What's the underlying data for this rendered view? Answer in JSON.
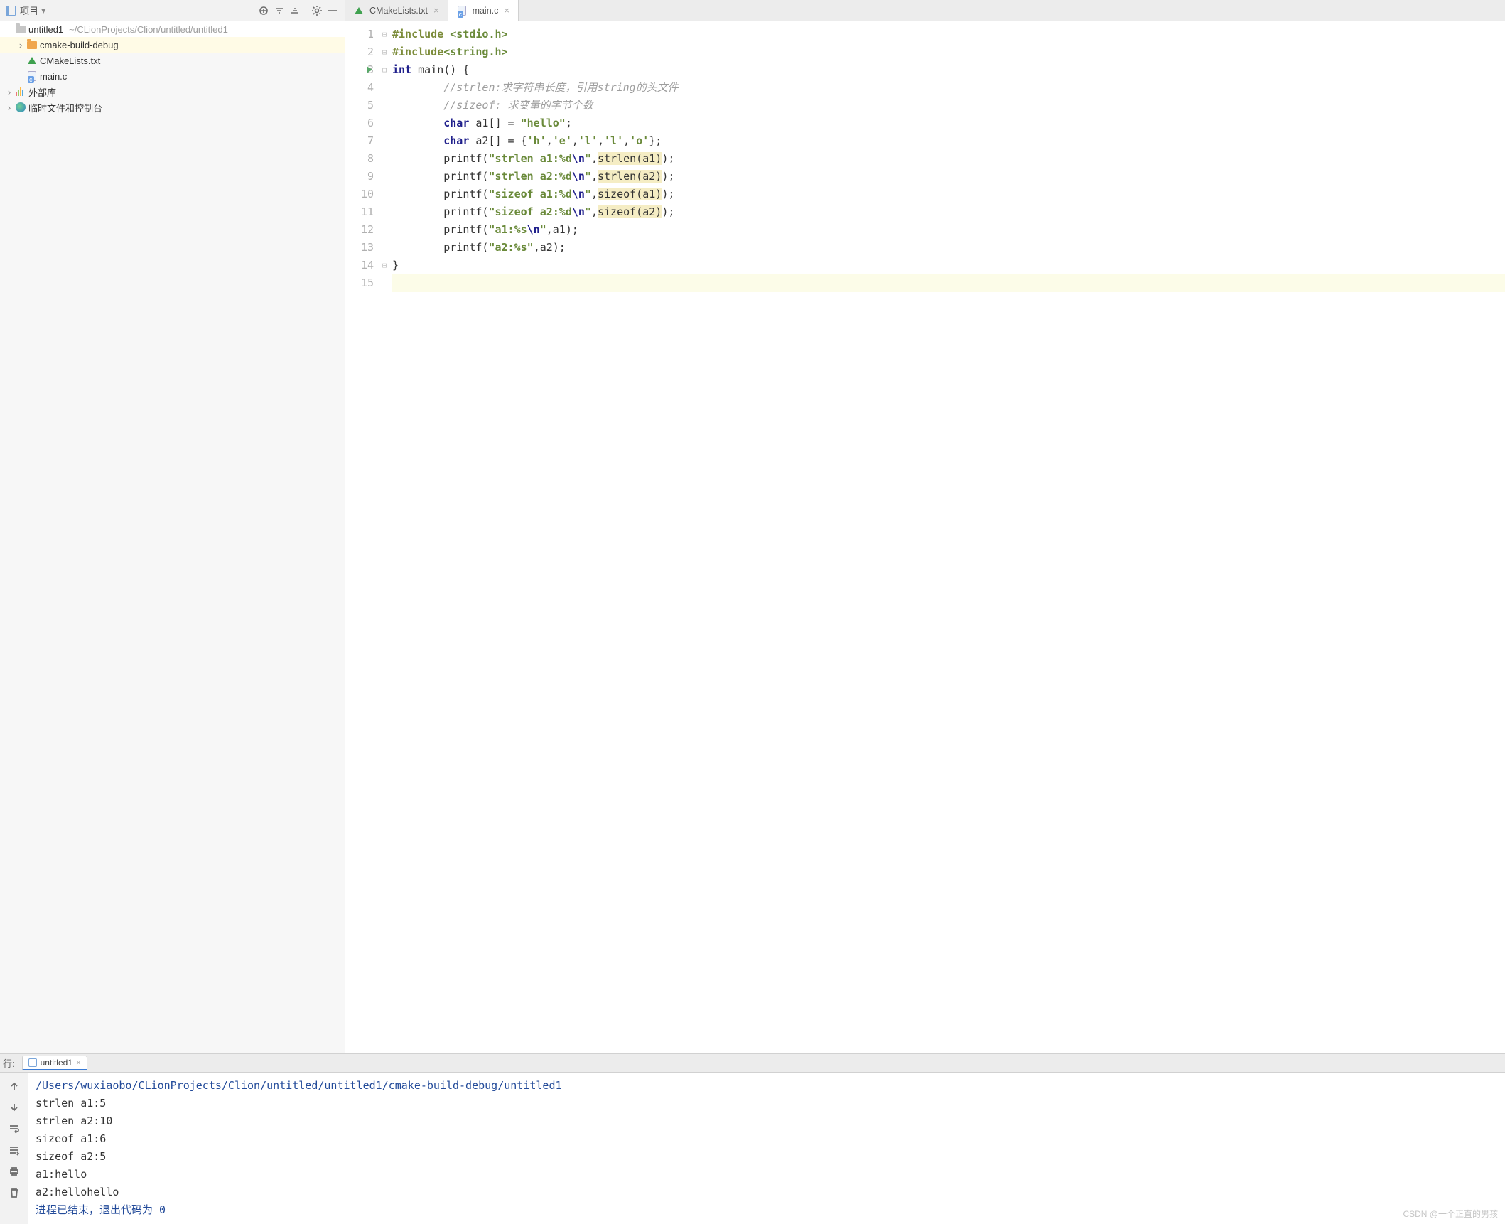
{
  "sidebar": {
    "title": "项目",
    "root": {
      "name": "untitled1",
      "path": "~/CLionProjects/Clion/untitled/untitled1"
    },
    "items": [
      {
        "name": "cmake-build-debug",
        "kind": "folder"
      },
      {
        "name": "CMakeLists.txt",
        "kind": "cmake"
      },
      {
        "name": "main.c",
        "kind": "cfile"
      }
    ],
    "external": "外部库",
    "scratch": "临时文件和控制台"
  },
  "tabs": [
    {
      "label": "CMakeLists.txt",
      "kind": "cmake",
      "active": false
    },
    {
      "label": "main.c",
      "kind": "cfile",
      "active": true
    }
  ],
  "code": {
    "lines": [
      [
        [
          "inc",
          "#include "
        ],
        [
          "inc-lib",
          "<stdio.h>"
        ]
      ],
      [
        [
          "inc",
          "#include"
        ],
        [
          "inc-lib",
          "<string.h>"
        ]
      ],
      [
        [
          "kw-navy",
          "int"
        ],
        [
          "",
          " main() {"
        ]
      ],
      [
        [
          "",
          "        "
        ],
        [
          "cm",
          "//strlen:求字符串长度，引用string的头文件"
        ]
      ],
      [
        [
          "",
          "        "
        ],
        [
          "cm",
          "//sizeof: 求变量的字节个数"
        ]
      ],
      [
        [
          "",
          "        "
        ],
        [
          "kw-navy",
          "char"
        ],
        [
          "",
          " a1[] = "
        ],
        [
          "str",
          "\"hello\""
        ],
        [
          "",
          ";"
        ]
      ],
      [
        [
          "",
          "        "
        ],
        [
          "kw-navy",
          "char"
        ],
        [
          "",
          " a2[] = {"
        ],
        [
          "str",
          "'h'"
        ],
        [
          "",
          ","
        ],
        [
          "str",
          "'e'"
        ],
        [
          "",
          ","
        ],
        [
          "str",
          "'l'"
        ],
        [
          "",
          ","
        ],
        [
          "str",
          "'l'"
        ],
        [
          "",
          ","
        ],
        [
          "str",
          "'o'"
        ],
        [
          "",
          "};"
        ]
      ],
      [
        [
          "",
          "        printf("
        ],
        [
          "str",
          "\"strlen a1:%d"
        ],
        [
          "esc",
          "\\n"
        ],
        [
          "str",
          "\""
        ],
        [
          "",
          ","
        ],
        [
          "warn-bg",
          "strlen(a1)"
        ],
        [
          "",
          ");"
        ]
      ],
      [
        [
          "",
          "        printf("
        ],
        [
          "str",
          "\"strlen a2:%d"
        ],
        [
          "esc",
          "\\n"
        ],
        [
          "str",
          "\""
        ],
        [
          "",
          ","
        ],
        [
          "warn-bg",
          "strlen(a2)"
        ],
        [
          "",
          ");"
        ]
      ],
      [
        [
          "",
          "        printf("
        ],
        [
          "str",
          "\"sizeof a1:%d"
        ],
        [
          "esc",
          "\\n"
        ],
        [
          "str",
          "\""
        ],
        [
          "",
          ","
        ],
        [
          "warn-bg",
          "sizeof(a1)"
        ],
        [
          "",
          ");"
        ]
      ],
      [
        [
          "",
          "        printf("
        ],
        [
          "str",
          "\"sizeof a2:%d"
        ],
        [
          "esc",
          "\\n"
        ],
        [
          "str",
          "\""
        ],
        [
          "",
          ","
        ],
        [
          "warn-bg",
          "sizeof(a2)"
        ],
        [
          "",
          ");"
        ]
      ],
      [
        [
          "",
          "        printf("
        ],
        [
          "str",
          "\"a1:%s"
        ],
        [
          "esc",
          "\\n"
        ],
        [
          "str",
          "\""
        ],
        [
          "",
          ",a1);"
        ]
      ],
      [
        [
          "",
          "        printf("
        ],
        [
          "str",
          "\"a2:%s\""
        ],
        [
          "",
          ",a2);"
        ]
      ],
      [
        [
          "",
          "}"
        ]
      ],
      [
        [
          "",
          ""
        ]
      ]
    ],
    "run_line": 3,
    "highlight_line": 15
  },
  "run": {
    "run_label": "行:",
    "tab": "untitled1",
    "path": "/Users/wuxiaobo/CLionProjects/Clion/untitled/untitled1/cmake-build-debug/untitled1",
    "out": [
      "strlen a1:5",
      "strlen a2:10",
      "sizeof a1:6",
      "sizeof a2:5",
      "a1:hello",
      "a2:hellohello"
    ],
    "exit": "进程已结束，退出代码为  0"
  },
  "watermark": "CSDN @一个正直的男孩"
}
